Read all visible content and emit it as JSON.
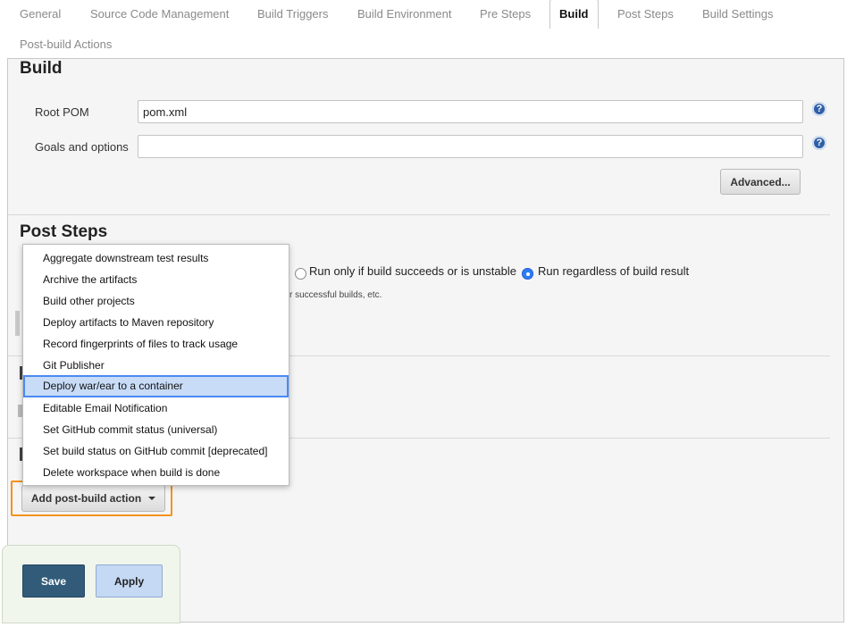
{
  "tabs": [
    {
      "label": "General"
    },
    {
      "label": "Source Code Management"
    },
    {
      "label": "Build Triggers"
    },
    {
      "label": "Build Environment"
    },
    {
      "label": "Pre Steps"
    },
    {
      "label": "Build",
      "active": true
    },
    {
      "label": "Post Steps"
    },
    {
      "label": "Build Settings"
    },
    {
      "label": "Post-build Actions"
    }
  ],
  "build": {
    "title": "Build",
    "root_pom_label": "Root POM",
    "root_pom_value": "pom.xml",
    "goals_label": "Goals and options",
    "goals_value": "",
    "advanced_label": "Advanced...",
    "help_glyph": "?"
  },
  "post_steps": {
    "title": "Post Steps",
    "radio_unstable": "Run only if build succeeds or is unstable",
    "radio_regardless": "Run regardless of build result",
    "selected": "regardless",
    "hint_fragment": "r successful builds, etc."
  },
  "dropdown": {
    "items": [
      "Aggregate downstream test results",
      "Archive the artifacts",
      "Build other projects",
      "Deploy artifacts to Maven repository",
      "Record fingerprints of files to track usage",
      "Git Publisher",
      "Deploy war/ear to a container",
      "Editable Email Notification",
      "Set GitHub commit status (universal)",
      "Set build status on GitHub commit [deprecated]",
      "Delete workspace when build is done"
    ],
    "highlighted_index": 6
  },
  "post_build": {
    "add_label": "Add post-build action"
  },
  "actions": {
    "save_label": "Save",
    "apply_label": "Apply"
  },
  "colors": {
    "highlight_border": "#4a8af0",
    "callout_orange": "#f5921e",
    "save_bg": "#315b79",
    "apply_bg": "#c5d9f4"
  }
}
